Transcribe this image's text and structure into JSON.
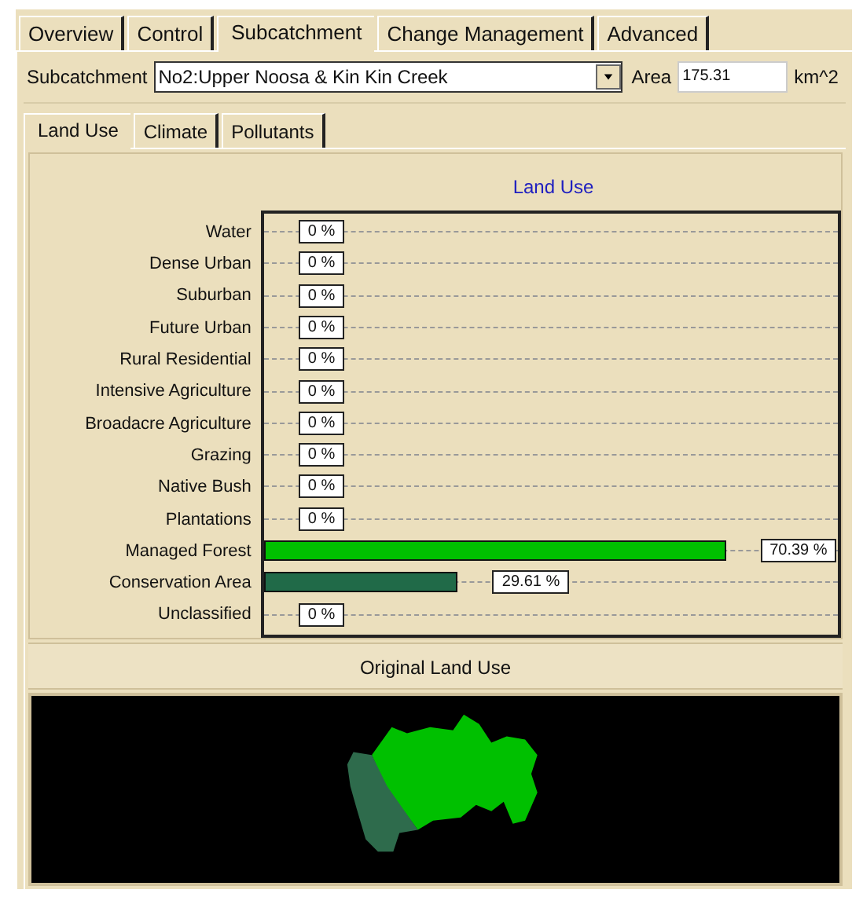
{
  "tabs": [
    {
      "label": "Overview",
      "selected": false
    },
    {
      "label": "Control",
      "selected": false
    },
    {
      "label": "Subcatchment",
      "selected": true
    },
    {
      "label": "Change Management",
      "selected": false
    },
    {
      "label": "Advanced",
      "selected": false
    }
  ],
  "subcatchment": {
    "label": "Subcatchment",
    "value": "No2:Upper Noosa & Kin Kin Creek",
    "area_label": "Area",
    "area_value": "175.31",
    "area_unit": "km^2"
  },
  "subtabs": [
    {
      "label": "Land Use",
      "selected": true
    },
    {
      "label": "Climate",
      "selected": false
    },
    {
      "label": "Pollutants",
      "selected": false
    }
  ],
  "land_use": {
    "chart_data": {
      "type": "bar",
      "orientation": "horizontal",
      "title": "Land Use",
      "xlim": [
        0,
        87.5
      ],
      "categories": [
        "Water",
        "Dense Urban",
        "Suburban",
        "Future Urban",
        "Rural Residential",
        "Intensive Agriculture",
        "Broadacre Agriculture",
        "Grazing",
        "Native Bush",
        "Plantations",
        "Managed Forest",
        "Conservation Area",
        "Unclassified"
      ],
      "values": [
        0,
        0,
        0,
        0,
        0,
        0,
        0,
        0,
        0,
        0,
        70.39,
        29.61,
        0
      ],
      "colors": [
        null,
        null,
        null,
        null,
        null,
        null,
        null,
        null,
        null,
        null,
        "#00c000",
        "#206a48",
        null
      ],
      "value_labels": [
        "0 %",
        "0 %",
        "0 %",
        "0 %",
        "0 %",
        "0 %",
        "0 %",
        "0 %",
        "0 %",
        "0 %",
        "70.39 %",
        "29.61 %",
        "0 %"
      ]
    }
  },
  "original_land_use": {
    "title": "Original Land Use"
  }
}
